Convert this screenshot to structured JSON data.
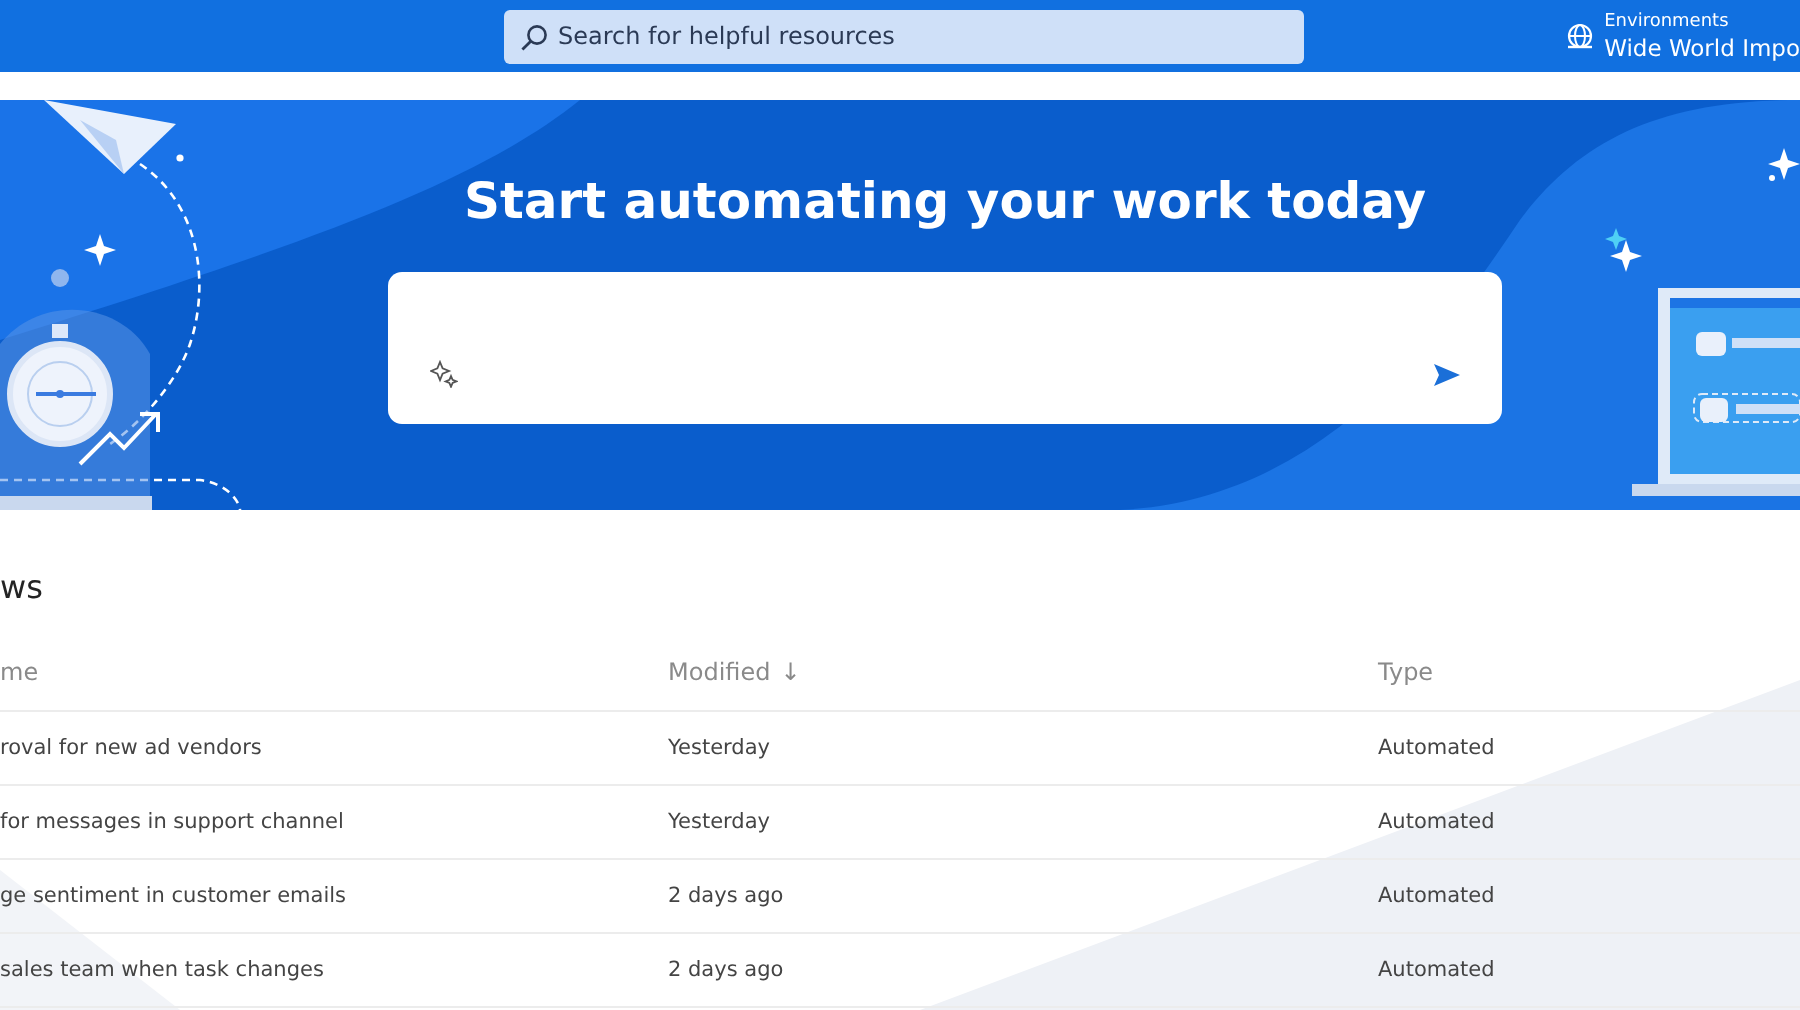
{
  "top_bar": {
    "search": {
      "placeholder": "Search for helpful resources"
    },
    "environment": {
      "label": "Environments",
      "name": "Wide World Impo"
    }
  },
  "banner": {
    "title": "Start automating your work today"
  },
  "flows": {
    "heading": "ws",
    "columns": [
      {
        "label": "me"
      },
      {
        "label": "Modified",
        "sort_indicator": "↓"
      },
      {
        "label": "Type"
      }
    ],
    "rows": [
      [
        "roval for new ad vendors",
        "Yesterday",
        "Automated"
      ],
      [
        "for messages in support channel",
        "Yesterday",
        "Automated"
      ],
      [
        "ge sentiment in customer emails",
        "2 days ago",
        "Automated"
      ],
      [
        "sales team when task changes",
        "2 days ago",
        "Automated"
      ]
    ]
  }
}
